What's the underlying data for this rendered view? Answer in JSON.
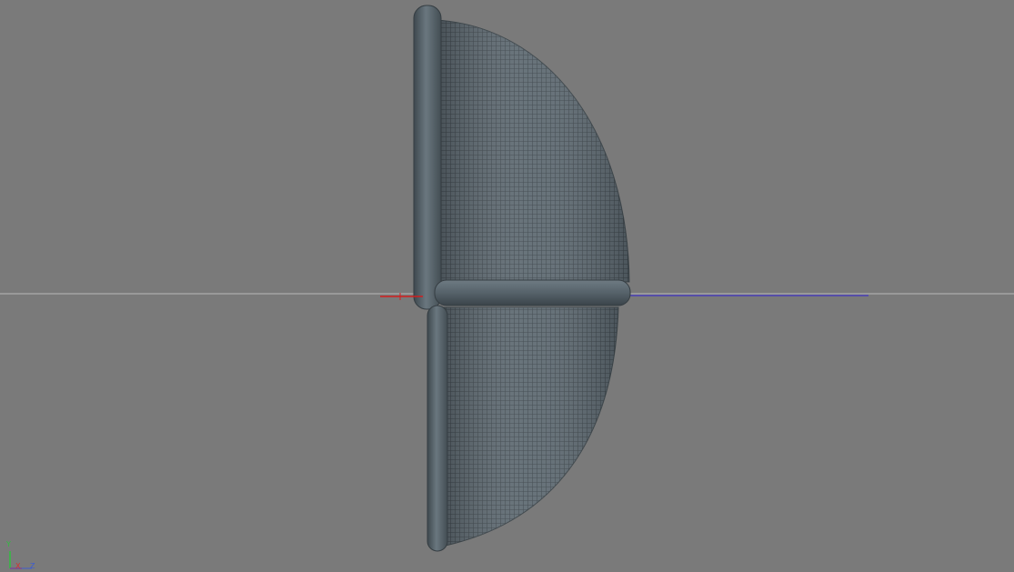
{
  "viewport": {
    "background_color": "#7a7a7a",
    "horizon_line_color": "#b8b8b8",
    "object": {
      "type": "wire-mesh strainer",
      "view": "side",
      "rim_color": "#56626a",
      "mesh_color": "#5e6a72",
      "mesh_line_color": "#3b444a"
    },
    "world_axes": {
      "x_color": "#d21e1e",
      "z_color": "#4a3fb8"
    }
  },
  "axis_gizmo": {
    "y_label": "Y",
    "x_label": "X",
    "z_label": "Z",
    "y_color": "#2fbf3f",
    "x_color": "#d63030",
    "z_color": "#3a5bd6"
  }
}
